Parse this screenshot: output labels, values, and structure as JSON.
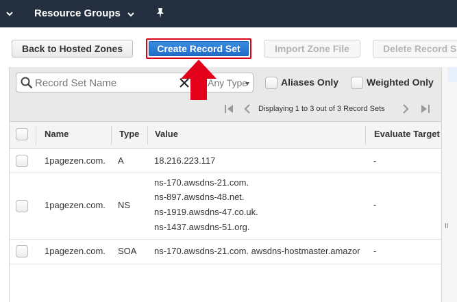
{
  "topnav": {
    "resource_groups": "Resource Groups"
  },
  "toolbar": {
    "back_label": "Back to Hosted Zones",
    "create_label": "Create Record Set",
    "import_label": "Import Zone File",
    "delete_label": "Delete Record Set"
  },
  "filter": {
    "search_placeholder": "Record Set Name",
    "type_placeholder": "Any Type",
    "aliases_only": "Aliases Only",
    "weighted_only": "Weighted Only",
    "pager_text": "Displaying 1 to 3 out of 3 Record Sets"
  },
  "table": {
    "columns": [
      "Name",
      "Type",
      "Value",
      "Evaluate Target"
    ],
    "rows": [
      {
        "name": "1pagezen.com.",
        "type": "A",
        "values": [
          "18.216.223.117"
        ],
        "evaluate": "-"
      },
      {
        "name": "1pagezen.com.",
        "type": "NS",
        "values": [
          "ns-170.awsdns-21.com.",
          "ns-897.awsdns-48.net.",
          "ns-1919.awsdns-47.co.uk.",
          "ns-1437.awsdns-51.org."
        ],
        "evaluate": "-"
      },
      {
        "name": "1pagezen.com.",
        "type": "SOA",
        "values": [
          "ns-170.awsdns-21.com. awsdns-hostmaster.amazor"
        ],
        "evaluate": "-"
      }
    ]
  },
  "colors": {
    "nav_bg": "#232f3e",
    "primary_button": "#1f6dc7",
    "highlight_red": "#e3001b"
  },
  "grip": "II"
}
